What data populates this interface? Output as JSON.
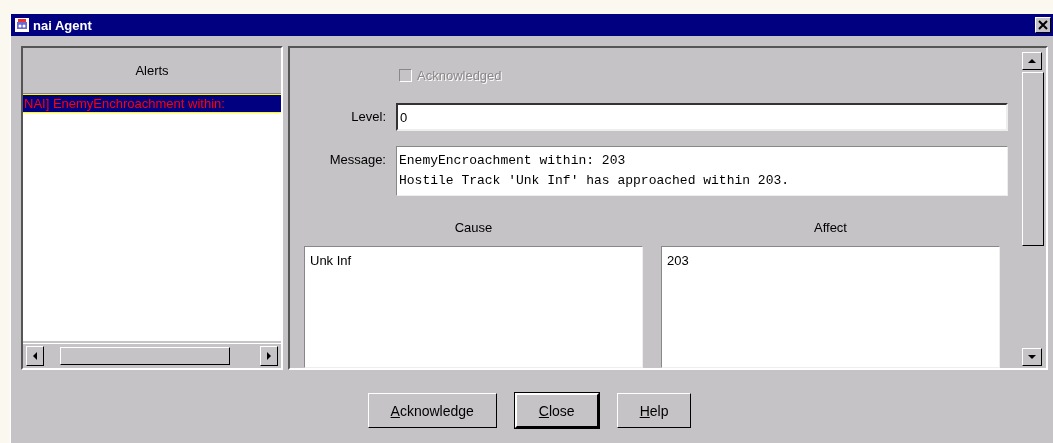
{
  "window": {
    "title": "nai Agent"
  },
  "alerts": {
    "header": "Alerts",
    "items": [
      {
        "text": "NAI] EnemyEnchroachment within:",
        "selected": true
      }
    ]
  },
  "details": {
    "acknowledged": {
      "label": "Acknowledged",
      "checked": false,
      "disabled": true
    },
    "level": {
      "label": "Level:",
      "value": "0"
    },
    "message": {
      "label": "Message:",
      "lines": [
        "EnemyEncroachment within: 203",
        "Hostile Track 'Unk Inf' has approached within 203."
      ]
    },
    "cause": {
      "header": "Cause",
      "value": "Unk Inf"
    },
    "affect": {
      "header": "Affect",
      "value": "203"
    }
  },
  "buttons": [
    {
      "label": "Acknowledge",
      "default": false
    },
    {
      "label": "Close",
      "default": true
    },
    {
      "label": "Help",
      "default": false
    }
  ]
}
